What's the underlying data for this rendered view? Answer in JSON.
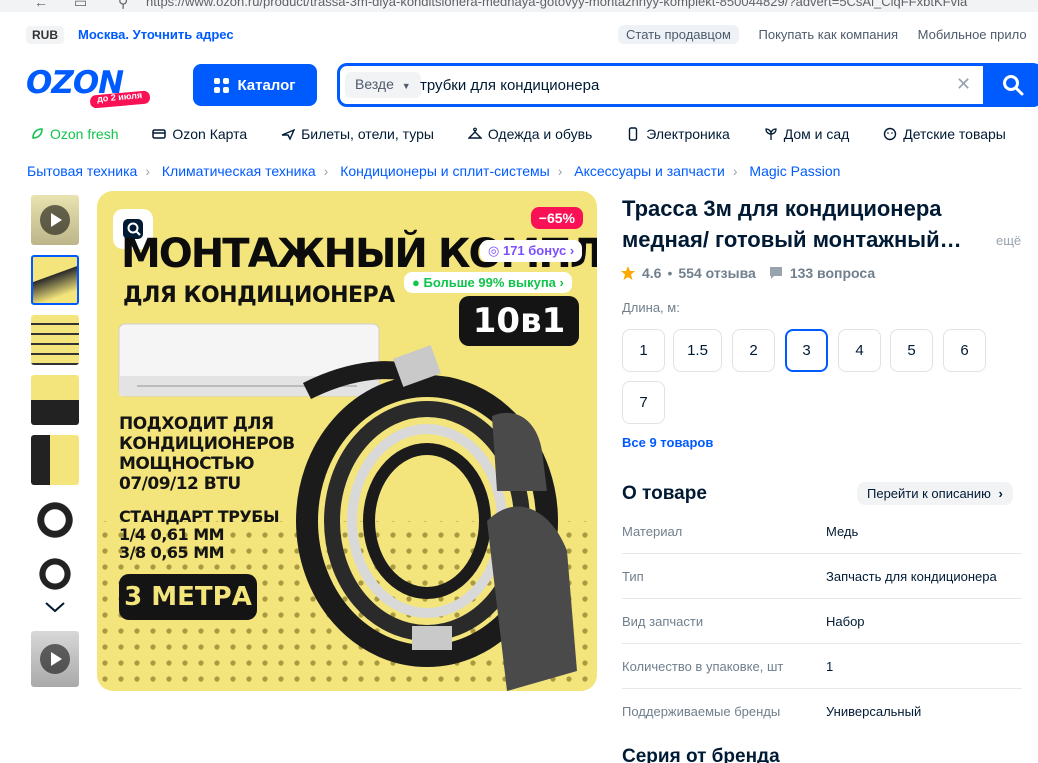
{
  "browser": {
    "url": "https://www.ozon.ru/product/trassa-3m-dlya-konditsionera-mednaya-gotovyy-montazhnyy-komplekt-850044829/?advert=5CsAl_CiqFFxbtKFvia"
  },
  "topbar": {
    "currency": "RUB",
    "city": "Москва. Уточнить адрес",
    "links": [
      "Стать продавцом",
      "Покупать как компания",
      "Мобильное прило"
    ]
  },
  "header": {
    "logo_text": "OZON",
    "logo_tagline": "до 2 июля",
    "catalog_label": "Каталог",
    "search_scope": "Везде",
    "search_value": "трубки для кондиционера"
  },
  "menu": [
    "Ozon fresh",
    "Ozon Карта",
    "Билеты, отели, туры",
    "Одежда и обувь",
    "Электроника",
    "Дом и сад",
    "Детские товары"
  ],
  "breadcrumbs": [
    "Бытовая техника",
    "Климатическая техника",
    "Кондиционеры и сплит-системы",
    "Аксессуары и запчасти",
    "Magic Passion"
  ],
  "image": {
    "discount": "−65%",
    "bonus": "171 бонус",
    "buyout": "Больше 99% выкупа",
    "headline": "МОНТАЖНЫЙ КОМПЛЕКТ",
    "subheadline": "ДЛЯ КОНДИЦИОНЕРА",
    "pieces": "10в1",
    "fits_lines": [
      "ПОДХОДИТ ДЛЯ",
      "КОНДИЦИОНЕРОВ",
      "МОЩНОСТЬЮ",
      "07/09/12 BTU"
    ],
    "standard_lines": [
      "СТАНДАРТ ТРУБЫ",
      "1/4 0,61 ММ",
      "3/8 0,65 ММ"
    ],
    "length_badge": "3 МЕТРА"
  },
  "product": {
    "title": "Трасса 3м для кондиционера медная/ готовый монтажный…",
    "more": "ещё",
    "rating": "4.6",
    "reviews": "554 отзыва",
    "questions": "133 вопроса",
    "length_label": "Длина, м:",
    "sizes": [
      "1",
      "1.5",
      "2",
      "3",
      "4",
      "5",
      "6",
      "7"
    ],
    "selected_size": "3",
    "all_goods": "Все 9 товаров"
  },
  "about": {
    "title": "О товаре",
    "goto_label": "Перейти к описанию",
    "specs": [
      {
        "key": "Материал",
        "value": "Медь"
      },
      {
        "key": "Тип",
        "value": "Запчасть для кондиционера"
      },
      {
        "key": "Вид запчасти",
        "value": "Набор"
      },
      {
        "key": "Количество в упаковке, шт",
        "value": "1"
      },
      {
        "key": "Поддерживаемые бренды",
        "value": "Универсальный"
      }
    ]
  },
  "series_title": "Серия от бренда",
  "colors": {
    "brand_blue": "#005bff",
    "discount_red": "#f91155",
    "fresh_green": "#10c44c",
    "image_yellow": "#f3e57b"
  }
}
